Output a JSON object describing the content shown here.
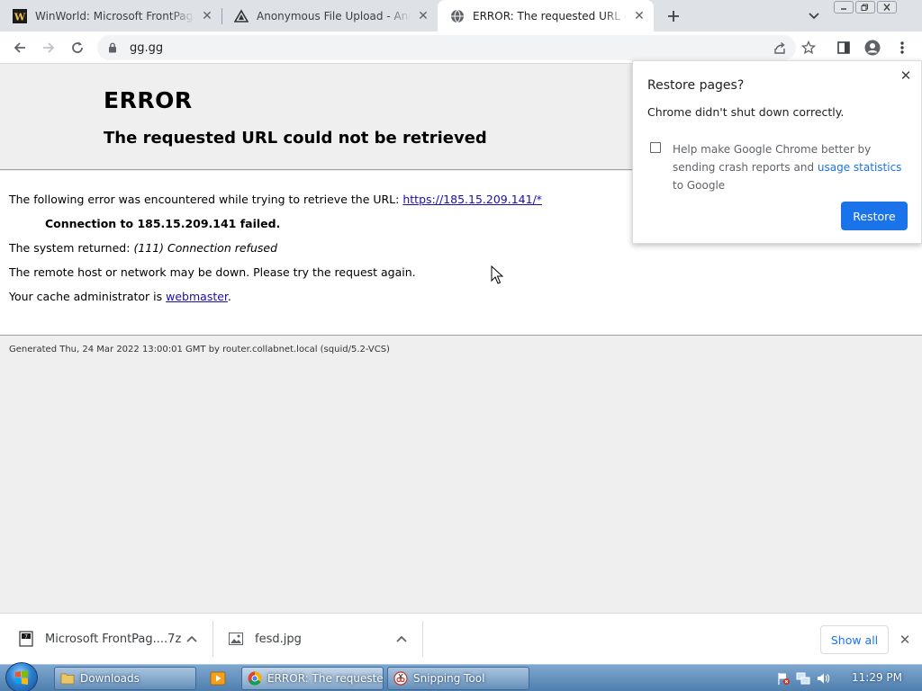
{
  "tabs": [
    {
      "title": "WinWorld: Microsoft FrontPage S",
      "favicon": "winworld-w-icon"
    },
    {
      "title": "Anonymous File Upload - AnonFi",
      "favicon": "anonfiles-icon"
    },
    {
      "title": "ERROR: The requested URL could",
      "favicon": "globe-icon",
      "active": true
    }
  ],
  "toolbar": {
    "url": "gg.gg"
  },
  "error_page": {
    "title": "ERROR",
    "subtitle": "The requested URL could not be retrieved",
    "line1_text": "The following error was encountered while trying to retrieve the URL:",
    "line1_link": "https://185.15.209.141/*",
    "line2": "Connection to 185.15.209.141 failed.",
    "line3_text": "The system returned:",
    "line3_em": "(111) Connection refused",
    "line4": "The remote host or network may be down. Please try the request again.",
    "line5_text": "Your cache administrator is",
    "line5_link": "webmaster",
    "line5_end": ".",
    "generated": "Generated Thu, 24 Mar 2022 13:00:01 GMT by router.collabnet.local (squid/5.2-VCS)"
  },
  "restore_popup": {
    "title": "Restore pages?",
    "message": "Chrome didn't shut down correctly.",
    "check_text": "Help make Google Chrome better by sending crash reports and",
    "check_link": "usage statistics",
    "check_end": "to Google",
    "restore_label": "Restore"
  },
  "downloads": {
    "items": [
      {
        "name": "Microsoft FrontPag....7z"
      },
      {
        "name": "fesd.jpg"
      }
    ],
    "show_all_label": "Show all"
  },
  "taskbar": {
    "buttons": [
      {
        "label": "Downloads"
      },
      {
        "label": "ERROR: The requeste..."
      },
      {
        "label": "Snipping Tool"
      }
    ],
    "clock": "11:29 PM"
  },
  "colors": {
    "accent": "#1a73e8",
    "link": "#1a0dab",
    "page_bg": "#efefef"
  }
}
